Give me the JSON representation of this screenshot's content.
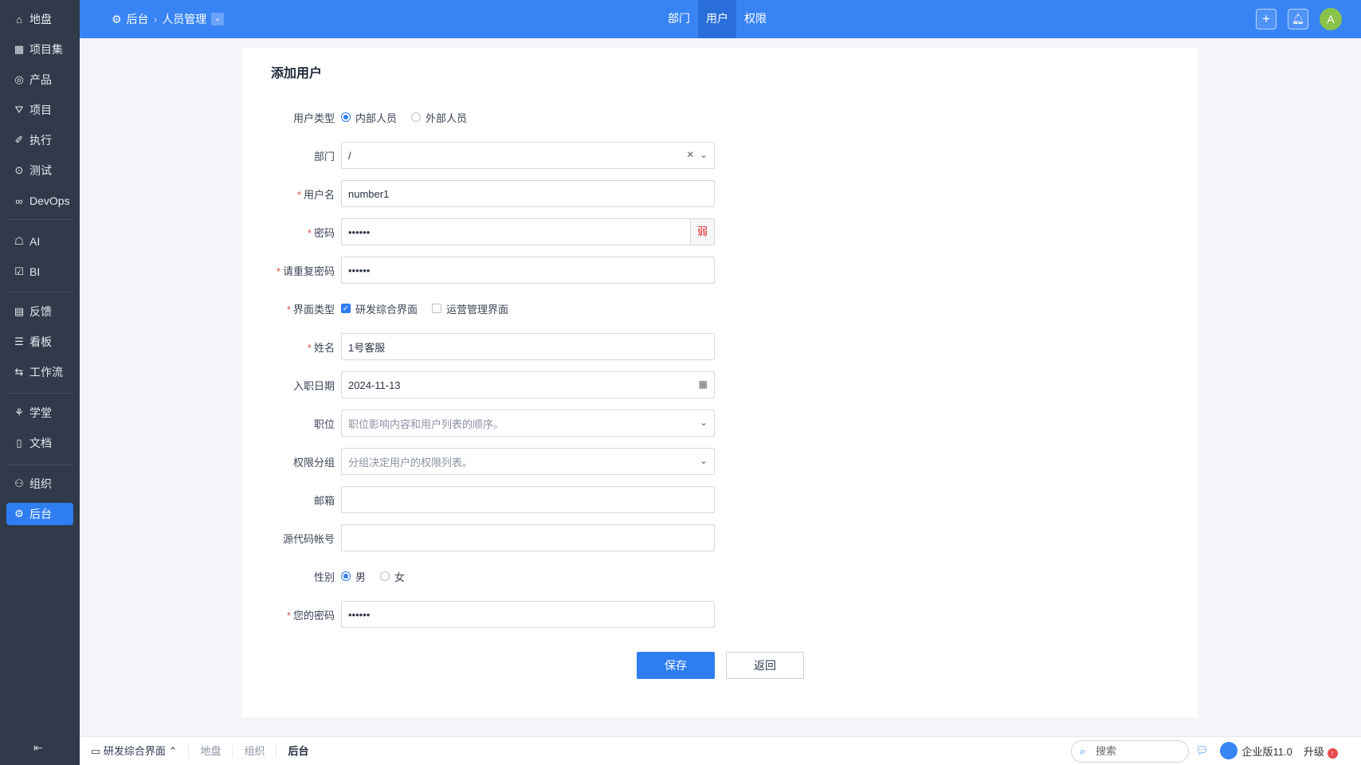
{
  "sidebar": {
    "items": [
      {
        "icon": "home-icon",
        "glyph": "⌂",
        "label": "地盘"
      },
      {
        "icon": "grid-icon",
        "glyph": "▦",
        "label": "项目集"
      },
      {
        "icon": "location-icon",
        "glyph": "◎",
        "label": "产品"
      },
      {
        "icon": "rocket-icon",
        "glyph": "⛛",
        "label": "项目"
      },
      {
        "icon": "execute-icon",
        "glyph": "✐",
        "label": "执行"
      },
      {
        "icon": "test-icon",
        "glyph": "⊙",
        "label": "测试"
      },
      {
        "icon": "infinity-icon",
        "glyph": "∞",
        "label": "DevOps"
      },
      {
        "icon": "robot-icon",
        "glyph": "☖",
        "label": "AI"
      },
      {
        "icon": "bi-icon",
        "glyph": "☑",
        "label": "BI"
      },
      {
        "icon": "feedback-icon",
        "glyph": "▤",
        "label": "反馈"
      },
      {
        "icon": "kanban-icon",
        "glyph": "☰",
        "label": "看板"
      },
      {
        "icon": "workflow-icon",
        "glyph": "⇆",
        "label": "工作流"
      },
      {
        "icon": "school-icon",
        "glyph": "⚘",
        "label": "学堂"
      },
      {
        "icon": "doc-icon",
        "glyph": "▯",
        "label": "文档"
      },
      {
        "icon": "org-icon",
        "glyph": "⚇",
        "label": "组织"
      },
      {
        "icon": "gear-icon",
        "glyph": "⚙",
        "label": "后台"
      }
    ]
  },
  "topbar": {
    "crumb_root": "后台",
    "crumb_current": "人员管理",
    "tabs": [
      "部门",
      "用户",
      "权限"
    ],
    "avatar": "A"
  },
  "form": {
    "title": "添加用户",
    "user_type_label": "用户类型",
    "user_type_options": [
      "内部人员",
      "外部人员"
    ],
    "dept_label": "部门",
    "dept_value": "/",
    "username_label": "用户名",
    "username_value": "number1",
    "password_label": "密码",
    "password_value": "••••••",
    "strength": "弱",
    "repeat_label": "请重复密码",
    "repeat_value": "••••••",
    "ui_label": "界面类型",
    "ui_options": [
      "研发综合界面",
      "运营管理界面"
    ],
    "name_label": "姓名",
    "name_value": "1号客服",
    "join_label": "入职日期",
    "join_value": "2024-11-13",
    "role_label": "职位",
    "role_placeholder": "职位影响内容和用户列表的顺序。",
    "group_label": "权限分组",
    "group_placeholder": "分组决定用户的权限列表。",
    "email_label": "邮箱",
    "scm_label": "源代码帐号",
    "gender_label": "性别",
    "gender_options": [
      "男",
      "女"
    ],
    "verify_label": "您的密码",
    "verify_value": "••••••",
    "save": "保存",
    "back": "返回"
  },
  "bottom": {
    "mode": "研发综合界面",
    "crumbs": [
      "地盘",
      "组织",
      "后台"
    ],
    "search": "搜索",
    "edition": "企业版11.0",
    "upgrade": "升级"
  },
  "colors": {
    "primary": "#3884f5",
    "sidebar": "#313a4a"
  }
}
